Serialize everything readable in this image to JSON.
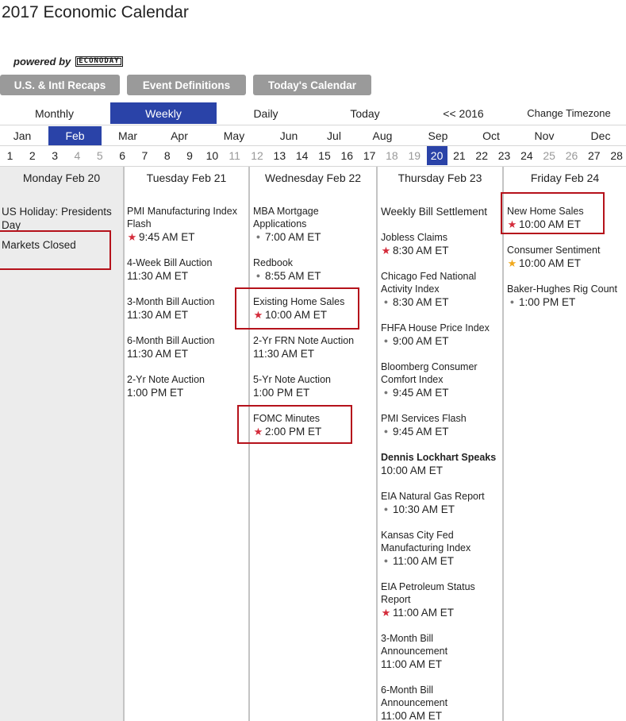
{
  "title": "2017 Economic Calendar",
  "powered_by": "powered by",
  "brand": "ECONODAY",
  "buttons": [
    "U.S. & Intl Recaps",
    "Event Definitions",
    "Today's Calendar"
  ],
  "views": {
    "monthly": "Monthly",
    "weekly": "Weekly",
    "daily": "Daily",
    "today": "Today",
    "prev_year": "<< 2016",
    "timezone": "Change Timezone",
    "active": "weekly"
  },
  "months": [
    "Jan",
    "Feb",
    "Mar",
    "Apr",
    "May",
    "Jun",
    "Jul",
    "Aug",
    "Sep",
    "Oct",
    "Nov",
    "Dec"
  ],
  "active_month": "Feb",
  "days": [
    "1",
    "2",
    "3",
    "4",
    "5",
    "6",
    "7",
    "8",
    "9",
    "10",
    "11",
    "12",
    "13",
    "14",
    "15",
    "16",
    "17",
    "18",
    "19",
    "20",
    "21",
    "22",
    "23",
    "24",
    "25",
    "26",
    "27",
    "28"
  ],
  "weekend_days": [
    "4",
    "5",
    "11",
    "12",
    "18",
    "19",
    "25",
    "26"
  ],
  "active_day": "20",
  "colors": {
    "accent": "#2a43a8",
    "button_gray": "#9a9a9a",
    "star_red": "#d42b3a",
    "star_gold": "#f0a81b",
    "highlight_box": "#b5121b",
    "holiday_bg": "#ececec"
  },
  "week": {
    "mon": {
      "header": "Monday Feb 20",
      "events": [
        {
          "name": "US Holiday: Presidents Day",
          "time": "",
          "icon": ""
        },
        {
          "name": "Markets Closed",
          "time": "",
          "icon": ""
        }
      ]
    },
    "tue": {
      "header": "Tuesday Feb 21",
      "events": [
        {
          "name": "PMI Manufacturing Index Flash",
          "time": "9:45 AM ET",
          "icon": "star-red"
        },
        {
          "name": "4-Week Bill Auction",
          "time": "11:30 AM ET",
          "icon": ""
        },
        {
          "name": "3-Month Bill Auction",
          "time": "11:30 AM ET",
          "icon": ""
        },
        {
          "name": "6-Month Bill Auction",
          "time": "11:30 AM ET",
          "icon": ""
        },
        {
          "name": "2-Yr Note Auction",
          "time": "1:00 PM ET",
          "icon": ""
        }
      ]
    },
    "wed": {
      "header": "Wednesday Feb 22",
      "events": [
        {
          "name": "MBA Mortgage Applications",
          "time": "7:00 AM ET",
          "icon": "dot"
        },
        {
          "name": "Redbook",
          "time": "8:55 AM ET",
          "icon": "dot"
        },
        {
          "name": "Existing Home Sales",
          "time": "10:00 AM ET",
          "icon": "star-red"
        },
        {
          "name": "2-Yr FRN Note Auction",
          "time": "11:30 AM ET",
          "icon": ""
        },
        {
          "name": "5-Yr Note Auction",
          "time": "1:00 PM ET",
          "icon": ""
        },
        {
          "name": "FOMC Minutes",
          "time": "2:00 PM ET",
          "icon": "star-red"
        }
      ]
    },
    "thu": {
      "header": "Thursday Feb 23",
      "events": [
        {
          "name": "Weekly Bill Settlement",
          "time": "",
          "icon": ""
        },
        {
          "name": "Jobless Claims",
          "time": "8:30 AM ET",
          "icon": "star-red"
        },
        {
          "name": "Chicago Fed National Activity Index",
          "time": "8:30 AM ET",
          "icon": "dot"
        },
        {
          "name": "FHFA House Price Index",
          "time": "9:00 AM ET",
          "icon": "dot"
        },
        {
          "name": "Bloomberg Consumer Comfort Index",
          "time": "9:45 AM ET",
          "icon": "dot"
        },
        {
          "name": "PMI Services Flash",
          "time": "9:45 AM ET",
          "icon": "dot"
        },
        {
          "name": "Dennis Lockhart Speaks",
          "time": "10:00 AM ET",
          "icon": ""
        },
        {
          "name": "EIA Natural Gas Report",
          "time": "10:30 AM ET",
          "icon": "dot"
        },
        {
          "name": "Kansas City Fed Manufacturing Index",
          "time": "11:00 AM ET",
          "icon": "dot"
        },
        {
          "name": "EIA Petroleum Status Report",
          "time": "11:00 AM ET",
          "icon": "star-red"
        },
        {
          "name": "3-Month Bill Announcement",
          "time": "11:00 AM ET",
          "icon": ""
        },
        {
          "name": "6-Month Bill Announcement",
          "time": "11:00 AM ET",
          "icon": ""
        }
      ]
    },
    "fri": {
      "header": "Friday Feb 24",
      "events": [
        {
          "name": "New Home Sales",
          "time": "10:00 AM ET",
          "icon": "star-red"
        },
        {
          "name": "Consumer Sentiment",
          "time": "10:00 AM ET",
          "icon": "star-gold"
        },
        {
          "name": "Baker-Hughes Rig Count",
          "time": "1:00 PM ET",
          "icon": "dot"
        }
      ]
    }
  }
}
